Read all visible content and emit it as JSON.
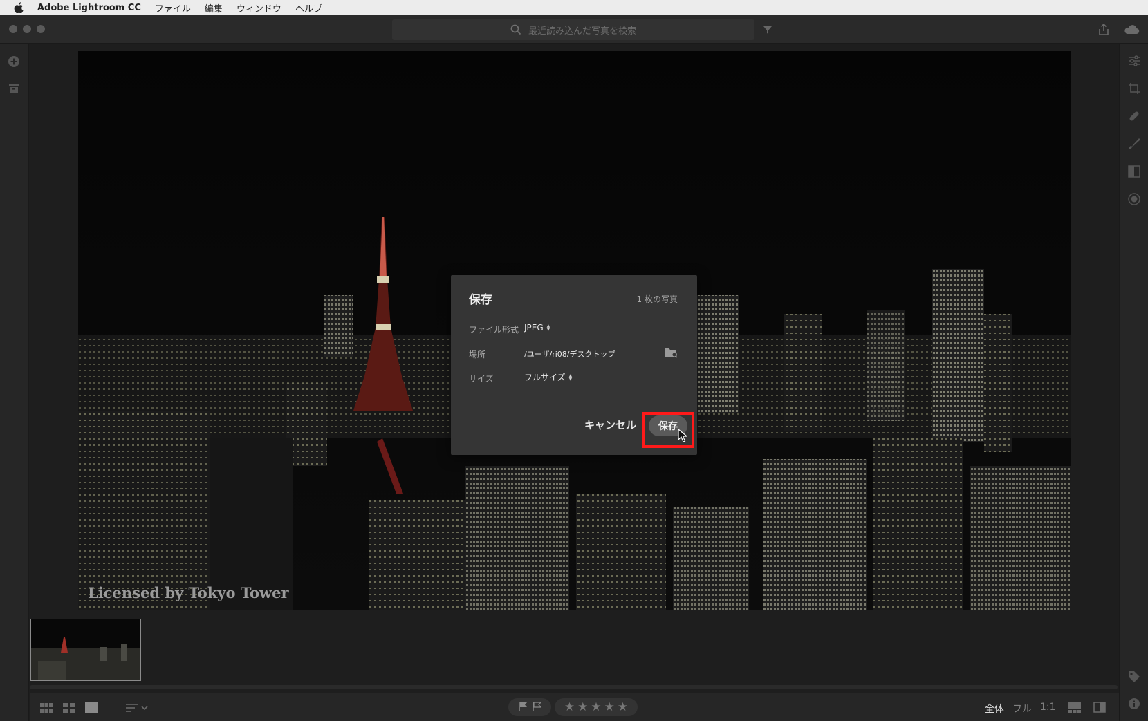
{
  "menubar": {
    "app_name": "Adobe Lightroom CC",
    "menus": [
      "ファイル",
      "編集",
      "ウィンドウ",
      "ヘルプ"
    ]
  },
  "titlebar": {
    "search_placeholder": "最近読み込んだ写真を検索"
  },
  "photo": {
    "watermark": "Licensed by Tokyo Tower"
  },
  "dialog": {
    "title": "保存",
    "photo_count": "1 枚の写真",
    "format_label": "ファイル形式",
    "format_value": "JPEG",
    "location_label": "場所",
    "location_value": "/ユーザ/ri08/デスクトップ",
    "size_label": "サイズ",
    "size_value": "フルサイズ",
    "cancel_label": "キャンセル",
    "save_label": "保存"
  },
  "bottombar": {
    "zoom_options": [
      "全体",
      "フル",
      "1:1"
    ],
    "active_zoom": "全体",
    "rating_stars": 0
  },
  "colors": {
    "highlight": "#ff1a1a",
    "panel": "#262626",
    "dialog": "#353535"
  }
}
